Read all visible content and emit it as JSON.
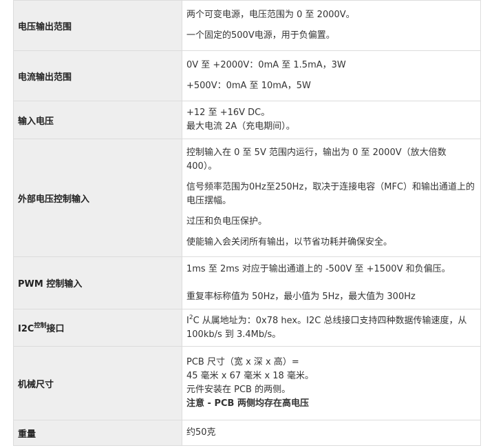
{
  "rows": [
    {
      "key": "电压输出范围",
      "lines": [
        "两个可变电源，电压范围为 0 至 2000V。",
        "一个固定的500V电源，用于负偏置。"
      ]
    },
    {
      "key": "电流输出范围",
      "lines": [
        "0V 至 +2000V：0mA 至 1.5mA，3W",
        "+500V：0mA 至 10mA，5W"
      ]
    },
    {
      "key": "输入电压",
      "lines": [
        "+12 至 +16V DC。",
        "最大电流 2A（充电期间）。"
      ]
    },
    {
      "key": "外部电压控制输入",
      "lines": [
        "控制输入在 0 至 5V 范围内运行，输出为 0 至 2000V（放大倍数 400）。",
        "信号频率范围为0Hz至250Hz，取决于连接电容（MFC）和输出通道上的电压摆幅。",
        "过压和负电压保护。",
        "使能输入会关闭所有输出，以节省功耗并确保安全。"
      ]
    },
    {
      "key": "PWM 控制输入",
      "lines": [
        "1ms 至 2ms 对应于输出通道上的 -500V 至 +1500V 和负偏压。",
        "重复率标称值为 50Hz，最小值为 5Hz，最大值为 300Hz"
      ]
    },
    {
      "key_parts": [
        "I2C",
        "控制",
        "接口"
      ],
      "value_parts": [
        "I",
        "2",
        "C 从属地址为：0x78 hex。I2C 总线接口支持四种数据传输速度，从 100kb/s 到 3.4Mb/s。"
      ]
    },
    {
      "key": "机械尺寸",
      "lines": [
        "PCB 尺寸（宽 x 深 x 高）=",
        "45 毫米 x 67 毫米 x 18 毫米。",
        "元件安装在 PCB 的两侧。",
        "注意 - PCB 两侧均存在高电压"
      ]
    },
    {
      "key": "重量",
      "lines": [
        "约50克"
      ]
    }
  ]
}
